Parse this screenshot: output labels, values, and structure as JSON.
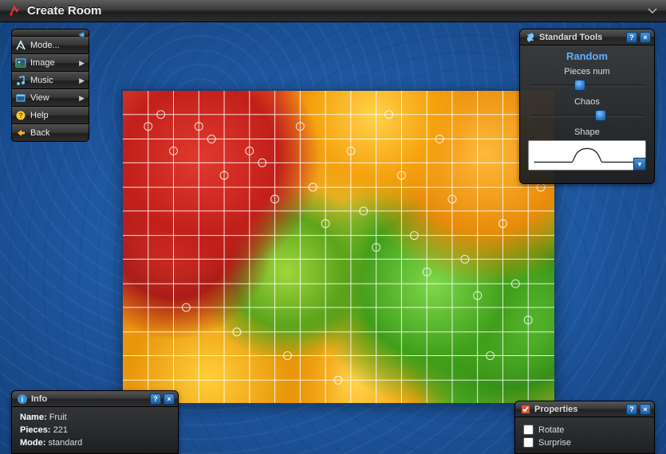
{
  "header": {
    "title": "Create Room"
  },
  "menu": {
    "items": [
      {
        "label": "Mode...",
        "icon": "mode"
      },
      {
        "label": "Image",
        "icon": "image",
        "arrow": true
      },
      {
        "label": "Music",
        "icon": "music",
        "arrow": true
      },
      {
        "label": "View",
        "icon": "view",
        "arrow": true
      },
      {
        "label": "Help",
        "icon": "help"
      },
      {
        "label": "Back",
        "icon": "back"
      }
    ]
  },
  "tools": {
    "title": "Standard Tools",
    "subtitle": "Random",
    "pieces_label": "Pieces num",
    "pieces_value": 0.5,
    "chaos_label": "Chaos",
    "chaos_value": 0.72,
    "shape_label": "Shape"
  },
  "info": {
    "title": "Info",
    "name_label": "Name:",
    "name_value": "Fruit",
    "pieces_label": "Pieces:",
    "pieces_value": "221",
    "mode_label": "Mode:",
    "mode_value": "standard"
  },
  "props": {
    "title": "Properties",
    "rotate_label": "Rotate",
    "rotate_checked": false,
    "surprise_label": "Surprise",
    "surprise_checked": false
  }
}
